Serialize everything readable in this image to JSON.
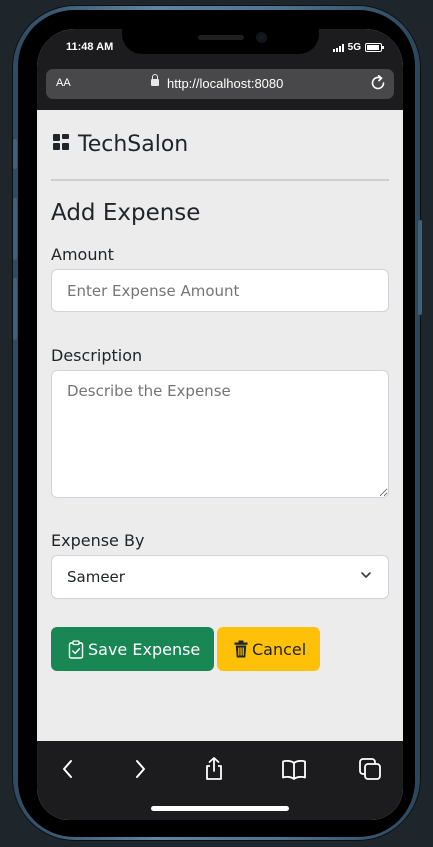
{
  "status_bar": {
    "time": "11:48 AM",
    "network": "5G"
  },
  "browser": {
    "text_size_label": "AA",
    "url": "http://localhost:8080"
  },
  "app": {
    "brand": "TechSalon"
  },
  "form": {
    "title": "Add Expense",
    "amount": {
      "label": "Amount",
      "placeholder": "Enter Expense Amount",
      "value": ""
    },
    "description": {
      "label": "Description",
      "placeholder": "Describe the Expense",
      "value": ""
    },
    "expense_by": {
      "label": "Expense By",
      "selected": "Sameer"
    },
    "save_label": "Save Expense",
    "cancel_label": "Cancel"
  },
  "colors": {
    "save": "#198754",
    "cancel": "#ffc107",
    "page_bg": "#ececec"
  },
  "icons": {
    "brand": "grid-icon",
    "save": "clipboard-check-icon",
    "cancel": "trash-icon",
    "toolbar": [
      "back-icon",
      "forward-icon",
      "share-icon",
      "bookmarks-icon",
      "tabs-icon"
    ]
  }
}
